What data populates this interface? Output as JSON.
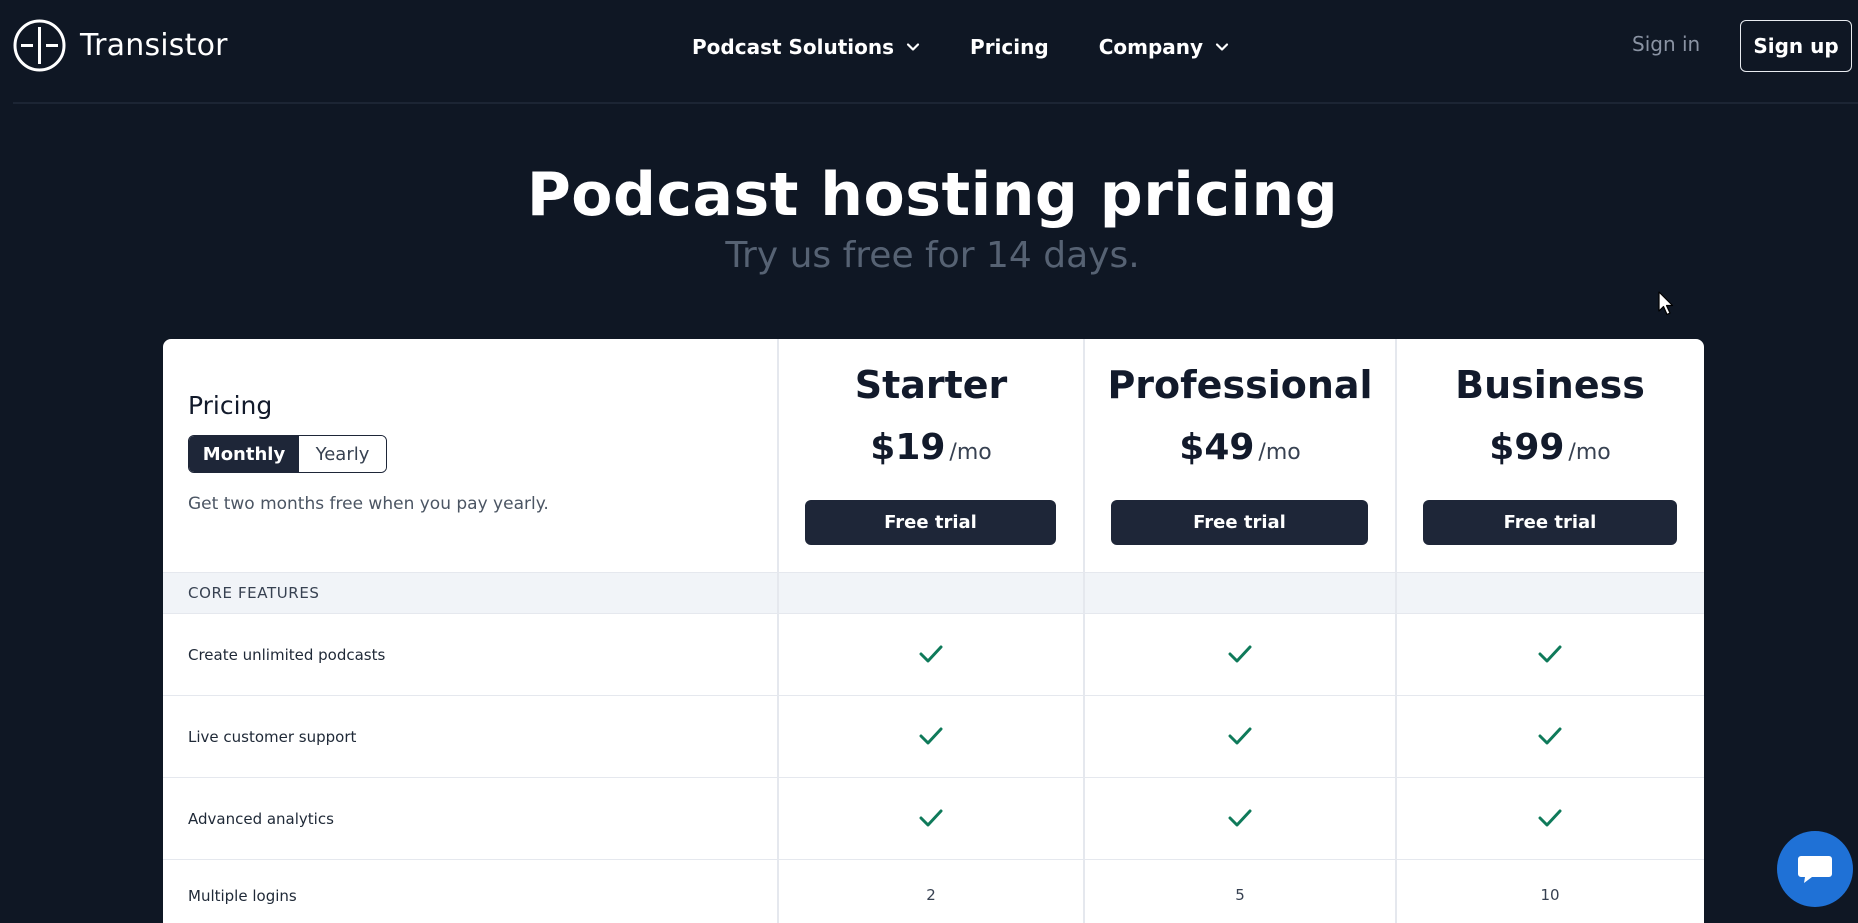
{
  "header": {
    "brand": "Transistor",
    "nav": [
      {
        "label": "Podcast Solutions",
        "has_dropdown": true
      },
      {
        "label": "Pricing",
        "has_dropdown": false
      },
      {
        "label": "Company",
        "has_dropdown": true
      }
    ],
    "sign_in": "Sign in",
    "sign_up": "Sign up"
  },
  "hero": {
    "title": "Podcast hosting pricing",
    "subtitle": "Try us free for 14 days."
  },
  "pricing": {
    "label": "Pricing",
    "toggle": {
      "monthly": "Monthly",
      "yearly": "Yearly",
      "selected": "Monthly"
    },
    "note": "Get two months free when you pay yearly.",
    "plans": [
      {
        "name": "Starter",
        "price": "$19",
        "period": "/mo",
        "cta": "Free trial"
      },
      {
        "name": "Professional",
        "price": "$49",
        "period": "/mo",
        "cta": "Free trial"
      },
      {
        "name": "Business",
        "price": "$99",
        "period": "/mo",
        "cta": "Free trial"
      }
    ],
    "section": "CORE FEATURES",
    "features": [
      {
        "label": "Create unlimited podcasts",
        "values": [
          "check",
          "check",
          "check"
        ]
      },
      {
        "label": "Live customer support",
        "values": [
          "check",
          "check",
          "check"
        ]
      },
      {
        "label": "Advanced analytics",
        "values": [
          "check",
          "check",
          "check"
        ]
      },
      {
        "label": "Multiple logins",
        "values": [
          "2",
          "5",
          "10"
        ]
      }
    ]
  },
  "colors": {
    "background": "#0f1724",
    "button": "#1e2638",
    "check": "#0f7a5a",
    "chat": "#1f71d6",
    "subtitle": "#566273"
  },
  "icons": {
    "logo": "transistor-logo-icon",
    "dropdown": "chevron-down-icon",
    "check": "check-icon",
    "chat": "chat-bubble-icon",
    "cursor": "mouse-cursor-icon"
  }
}
